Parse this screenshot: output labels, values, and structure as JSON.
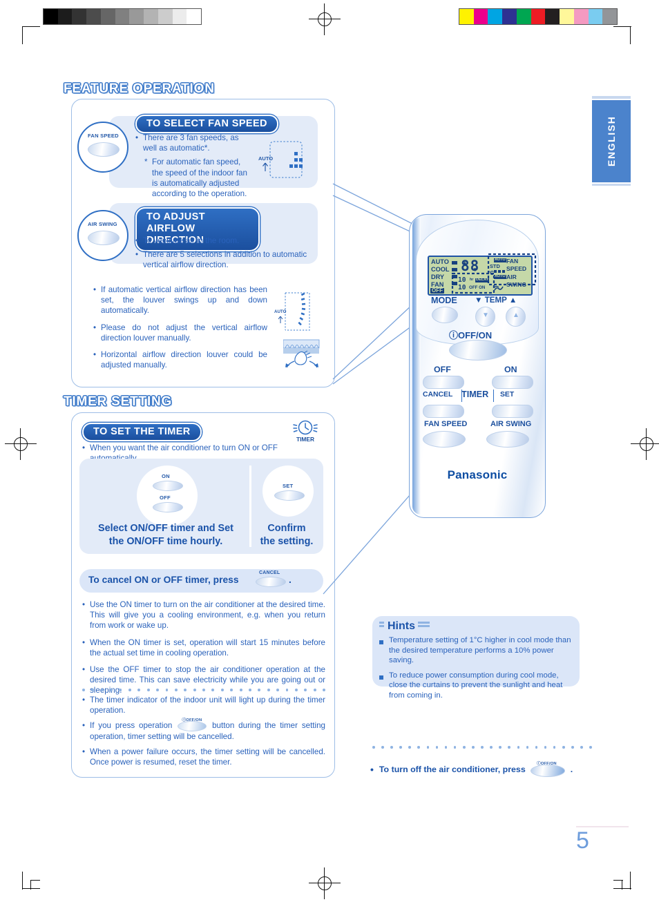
{
  "page": {
    "number": "5",
    "language_tab": "ENGLISH"
  },
  "print_marks": {
    "gray_scale": [
      "#000000",
      "#1c1c1c",
      "#333333",
      "#4c4c4c",
      "#666666",
      "#808080",
      "#999999",
      "#b3b3b3",
      "#cccccc",
      "#ececec",
      "#ffffff"
    ],
    "color_patches": [
      "#fff200",
      "#ec008c",
      "#00a5e3",
      "#2e3192",
      "#00a651",
      "#ed1c24",
      "#231f20",
      "#fff79a",
      "#f49ac1",
      "#7accf0",
      "#939598"
    ]
  },
  "sections": [
    {
      "id": "feature-operation",
      "title": "FEATURE OPERATION"
    },
    {
      "id": "timer-setting",
      "title": "TIMER SETTING"
    }
  ],
  "fan_speed": {
    "button_label": "FAN SPEED",
    "heading": "TO SELECT FAN SPEED",
    "bullets": [
      "There are 3 fan speeds, as well as automatic*.",
      "For automatic fan speed, the speed of the indoor fan is automatically adjusted according to the operation."
    ],
    "bullet_markers": [
      "•",
      "*"
    ],
    "diagram_label": "AUTO"
  },
  "air_swing": {
    "button_label": "AIR SWING",
    "heading_line1": "TO ADJUST AIRFLOW",
    "heading_line2": "DIRECTION",
    "bullets_top": [
      "To ventilate air in the room.",
      "There are 5 selections in addition to automatic vertical airflow direction."
    ],
    "bullets_bottom": [
      "If automatic vertical airflow direction has been set, the louver swings up and down automatically.",
      "Please do not adjust the vertical airflow direction louver manually.",
      "Horizontal airflow direction louver could be adjusted manually."
    ],
    "diagram_label": "AUTO"
  },
  "timer": {
    "heading": "TO SET THE TIMER",
    "icon_label": "TIMER",
    "intro_bullet": "When you want the air conditioner to turn ON or OFF automatically.",
    "step_left": {
      "key_top_label": "ON",
      "key_bottom_label": "OFF",
      "caption_line1": "Select ON/OFF timer and Set",
      "caption_line2": "the ON/OFF time hourly."
    },
    "step_right": {
      "key_label": "SET",
      "caption_line1": "Confirm",
      "caption_line2": "the setting."
    },
    "cancel_bar": {
      "text_before": "To cancel ON or OFF timer, press",
      "key_label": "CANCEL",
      "text_after": "."
    },
    "bullets_group1": [
      "Use the ON timer to turn on the air conditioner at the desired time. This will give you a cooling environment, e.g. when you return from work or wake up.",
      "When the ON timer is set, operation will start 15 minutes before the actual set time in cooling operation.",
      "Use the OFF timer to stop the air conditioner operation at the desired time. This can save electricity while you are going out or sleeping."
    ],
    "bullets_group2": [
      {
        "text": "The timer indicator of the indoor unit will light up during the timer operation."
      },
      {
        "text_before": "If you press operation",
        "key_label": "ⓘOFF/ON",
        "text_after": "button during the timer setting operation, timer setting will be cancelled."
      },
      {
        "text": "When a power failure occurs, the timer setting will be cancelled. Once power is resumed, reset the timer."
      }
    ]
  },
  "remote": {
    "brand": "Panasonic",
    "lcd": {
      "modes": [
        "AUTO",
        "COOL",
        "DRY",
        "FAN"
      ],
      "off_label": "OFF",
      "temp_unit": "°C",
      "std_label": "STD",
      "digits_main": "88",
      "digits_timer_top": "10",
      "digits_timer_bottom": "10",
      "hr_label": "hr",
      "delay_label": "DELAY",
      "offon_label": "OFF ON",
      "fan_speed_label_line1": "FAN",
      "fan_speed_label_line2": "SPEED",
      "air_swing_label_line1": "AIR",
      "air_swing_label_line2": "SWING",
      "auto_label_fan": "AUTO",
      "auto_label_swing": "AUTO"
    },
    "buttons": {
      "mode": "MODE",
      "temp": "▼ TEMP ▲",
      "power": "ⓘOFF/ON",
      "timer_off": "OFF",
      "timer_on": "ON",
      "cancel": "CANCEL",
      "timer": "TIMER",
      "set": "SET",
      "fan_speed": "FAN SPEED",
      "air_swing": "AIR SWING"
    }
  },
  "hints": {
    "title": "Hints",
    "items": [
      "Temperature setting of 1°C higher in cool mode than the desired temperature performs a 10% power saving.",
      "To reduce power consumption during cool mode, close the curtains to prevent the sunlight and heat from coming in."
    ]
  },
  "footer_note": {
    "text_before": "To turn off the air conditioner, press",
    "key_label": "ⓘOFF/ON",
    "text_after": "."
  },
  "colors": {
    "brand_blue": "#2a62bb",
    "heading_fill": "#ffffff",
    "heading_outline": "#3b78c8",
    "panel_border": "#9dbde6",
    "card_bg": "#e3ebf8",
    "lcd_bg": "#c5d8a8",
    "tab_bg": "#4b83cc",
    "page_number": "#6e9ddc"
  }
}
